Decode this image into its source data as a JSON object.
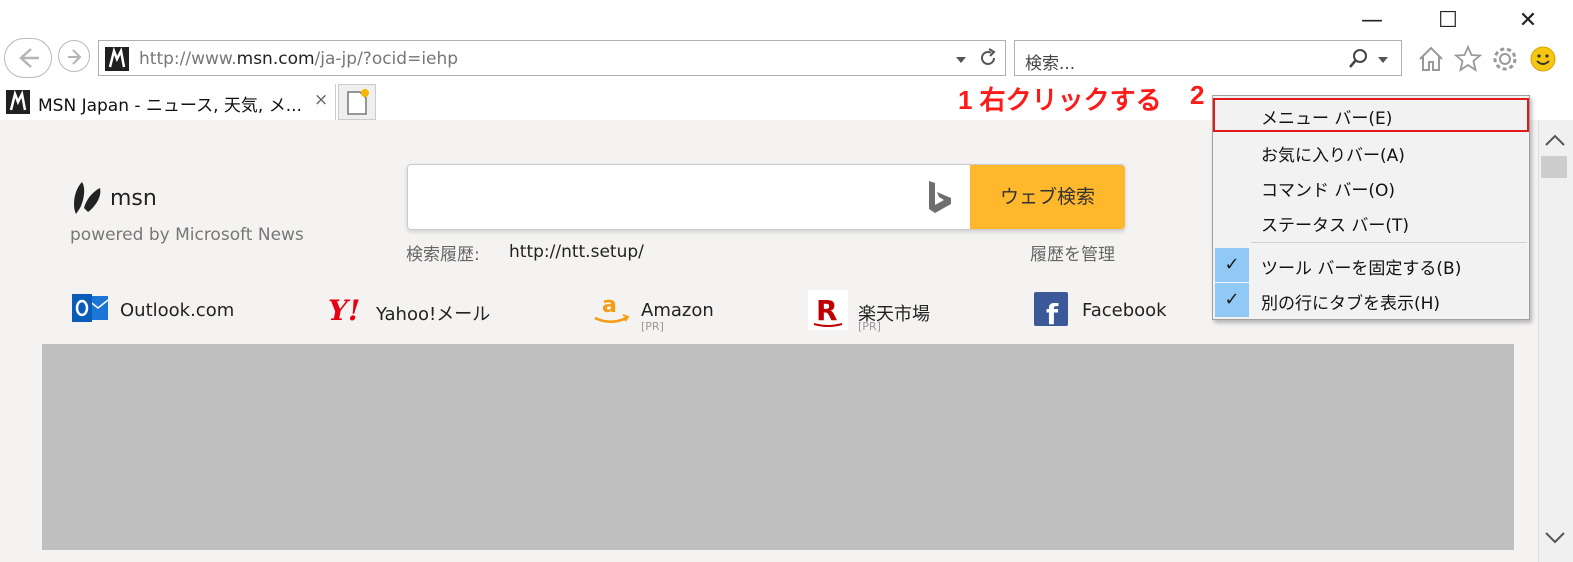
{
  "window": {
    "minimize_label": "—",
    "maximize_label": "☐",
    "close_label": "✕"
  },
  "addressbar": {
    "url_prefix": "http://www.",
    "url_domain": "msn.com",
    "url_suffix": "/ja-jp/?ocid=iehp"
  },
  "searchbox": {
    "placeholder": "検索..."
  },
  "tab": {
    "title": "MSN Japan - ニュース, 天気, メ...",
    "close": "×"
  },
  "annotations": {
    "step1": "1 右クリックする",
    "step2": "2"
  },
  "msn": {
    "brand": "msn",
    "powered": "powered by Microsoft News",
    "search_button": "ウェブ検索",
    "history_label": "検索履歴:",
    "history_url": "http://ntt.setup/",
    "history_manage": "履歴を管理"
  },
  "links": [
    {
      "label": "Outlook.com",
      "pr": ""
    },
    {
      "label": "Yahoo!メール",
      "pr": ""
    },
    {
      "label": "Amazon",
      "pr": "[PR]"
    },
    {
      "label": "楽天市場",
      "pr": "[PR]"
    },
    {
      "label": "Facebook",
      "pr": ""
    }
  ],
  "menu": {
    "items": [
      {
        "label": "メニュー バー(E)",
        "checked": false
      },
      {
        "label": "お気に入りバー(A)",
        "checked": false
      },
      {
        "label": "コマンド バー(O)",
        "checked": false
      },
      {
        "label": "ステータス バー(T)",
        "checked": false
      },
      {
        "label": "ツール バーを固定する(B)",
        "checked": true
      },
      {
        "label": "別の行にタブを表示(H)",
        "checked": true
      }
    ],
    "check_glyph": "✓"
  },
  "colors": {
    "annotation": "#ff1a1a",
    "search_button": "#ffb72c",
    "menu_check": "#90c8f6"
  }
}
